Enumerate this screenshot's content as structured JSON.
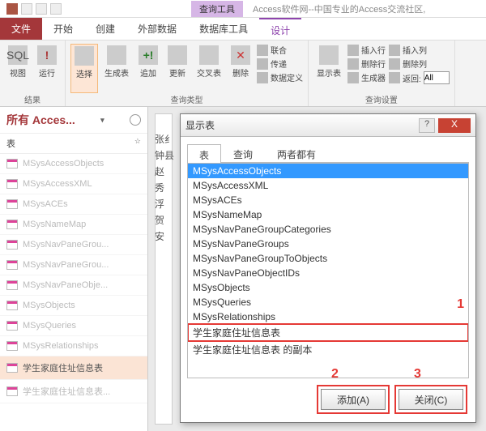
{
  "titlebar": {
    "context_tab": "查询工具",
    "app_title": "Access软件网--中国专业的Access交流社区,"
  },
  "tabs": {
    "file": "文件",
    "items": [
      "开始",
      "创建",
      "外部数据",
      "数据库工具",
      "设计"
    ],
    "active": "设计"
  },
  "ribbon": {
    "group1": {
      "sql": "SQL",
      "view": "视图",
      "run": "运行",
      "label": "结果"
    },
    "group2": {
      "select": "选择",
      "maketable": "生成表",
      "append": "追加",
      "update": "更新",
      "crosstab": "交叉表",
      "delete": "删除",
      "union": "联合",
      "passthrough": "传递",
      "datadef": "数据定义",
      "label": "查询类型"
    },
    "group3": {
      "showtable": "显示表",
      "insrows": "插入行",
      "delrows": "删除行",
      "builder": "生成器",
      "inscols": "插入列",
      "delcols": "删除列",
      "return": "返回:",
      "return_val": "All",
      "label": "查询设置"
    }
  },
  "nav": {
    "header": "所有 Acces...",
    "subheader": "表",
    "items": [
      "MSysAccessObjects",
      "MSysAccessXML",
      "MSysACEs",
      "MSysNameMap",
      "MSysNavPaneGrou...",
      "MSysNavPaneGrou...",
      "MSysNavPaneObje...",
      "MSysObjects",
      "MSysQueries",
      "MSysRelationships",
      "学生家庭住址信息表",
      "学生家庭住址信息表..."
    ],
    "selected_index": 10
  },
  "main": {
    "names": [
      "张纟",
      "钟县",
      "赵",
      "秀",
      "浮",
      "贺",
      "安"
    ]
  },
  "dialog": {
    "title": "显示表",
    "help": "?",
    "close": "X",
    "tabs": [
      "表",
      "查询",
      "两者都有"
    ],
    "active_tab": 0,
    "items": [
      "MSysAccessObjects",
      "MSysAccessXML",
      "MSysACEs",
      "MSysNameMap",
      "MSysNavPaneGroupCategories",
      "MSysNavPaneGroups",
      "MSysNavPaneGroupToObjects",
      "MSysNavPaneObjectIDs",
      "MSysObjects",
      "MSysQueries",
      "MSysRelationships",
      "学生家庭住址信息表",
      "学生家庭住址信息表 的副本"
    ],
    "selected_index": 0,
    "highlight_index": 11,
    "add": "添加(A)",
    "close_btn": "关闭(C)",
    "anno1": "1",
    "anno2": "2",
    "anno3": "3"
  }
}
